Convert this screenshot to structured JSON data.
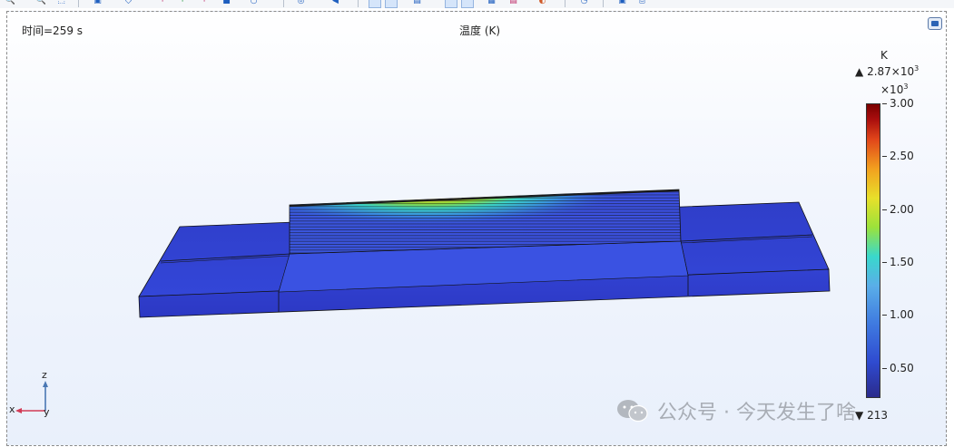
{
  "toolbar": {
    "icons": [
      "zoom-in-icon",
      "zoom-out-icon",
      "zoom-box-icon",
      "export-icon",
      "draw-icon",
      "select-box-icon",
      "deselect-icon",
      "build-icon",
      "record-icon",
      "rotate-icon",
      "camera-icon",
      "arrow-icon",
      "toggle-grid-icon",
      "toggle-wireframe-icon",
      "view-icon",
      "capture-icon",
      "grid-icon",
      "paint-icon",
      "refresh-icon",
      "save-icon",
      "print-icon"
    ]
  },
  "plot": {
    "time_label": "时间=259 s",
    "title": "温度 (K)"
  },
  "colorbar": {
    "unit": "K",
    "max_marker": "▲",
    "max_value": "2.87×10",
    "max_exp": "3",
    "scale_factor": "×10",
    "scale_exp": "3",
    "ticks": [
      "3.00",
      "2.50",
      "2.00",
      "1.50",
      "1.00",
      "0.50"
    ],
    "tick_values": [
      3.0,
      2.5,
      2.0,
      1.5,
      1.0,
      0.5
    ],
    "range": [
      0.213,
      3.0
    ],
    "min_marker": "▼",
    "min_value": "213",
    "colormap_colors": [
      "#2b2b8c",
      "#2f4bd0",
      "#5aaee8",
      "#39d8cc",
      "#9be23b",
      "#e8e02a",
      "#f2a01f",
      "#e1461a",
      "#7a0000"
    ]
  },
  "axes": {
    "z": "z",
    "x": "x",
    "y": "y"
  },
  "watermark": {
    "text": "公众号 · 今天发生了啥"
  },
  "colors": {
    "substrate": "#2c3fd6",
    "deposit_side": "#3b4fde",
    "accent": "#1f5fbf"
  }
}
